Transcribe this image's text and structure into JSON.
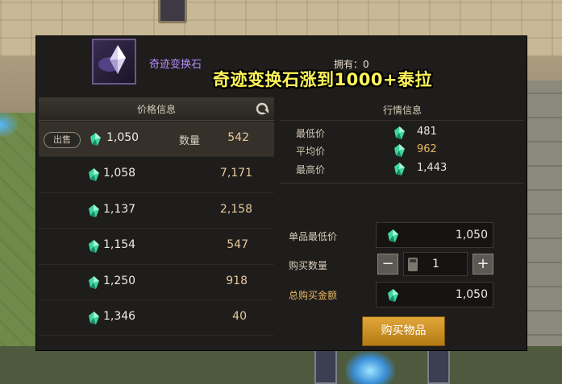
{
  "item": {
    "name": "奇迹变换石",
    "owned_label": "拥有：",
    "owned_count": "0"
  },
  "overlay_caption": "奇迹变换石涨到1000+泰拉",
  "price_panel": {
    "title": "价格信息",
    "sell_label": "出售",
    "qty_label": "数量",
    "listings": [
      {
        "price": "1,050",
        "qty": "542"
      },
      {
        "price": "1,058",
        "qty": "7,171"
      },
      {
        "price": "1,137",
        "qty": "2,158"
      },
      {
        "price": "1,154",
        "qty": "547"
      },
      {
        "price": "1,250",
        "qty": "918"
      },
      {
        "price": "1,346",
        "qty": "40"
      }
    ]
  },
  "market": {
    "title": "行情信息",
    "lowest_label": "最低价",
    "lowest": "481",
    "average_label": "平均价",
    "average": "962",
    "highest_label": "最高价",
    "highest": "1,443"
  },
  "purchase": {
    "unit_price_label": "单品最低价",
    "unit_price": "1,050",
    "quantity_label": "购买数量",
    "quantity": "1",
    "minus": "−",
    "plus": "+",
    "total_label": "总购买金额",
    "total": "1,050",
    "buy_button": "购买物品"
  },
  "colors": {
    "gem": "#3fd6a0",
    "accent_gold": "#e8b865",
    "item_name_purple": "#b58cff",
    "caption_yellow": "#fff45a"
  },
  "icons": {
    "currency": "tera-gem-icon",
    "refresh": "refresh-icon",
    "item": "miracle-stone-icon",
    "calculator": "calculator-icon"
  }
}
